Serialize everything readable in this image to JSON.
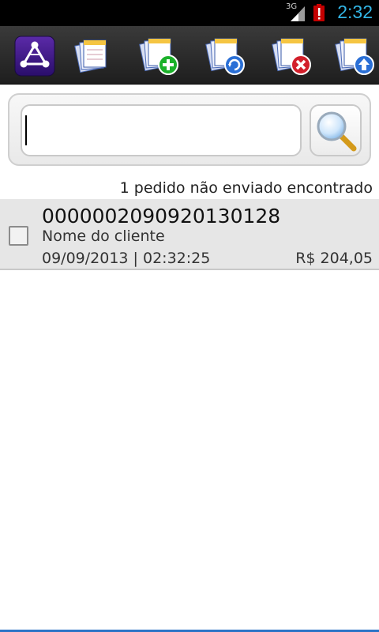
{
  "status_bar": {
    "network": "3G",
    "time": "2:32",
    "clock_color": "#33b5e5"
  },
  "toolbar": {
    "buttons": [
      {
        "icon": "app-logo-icon"
      },
      {
        "icon": "orders-icon"
      },
      {
        "icon": "new-order-icon"
      },
      {
        "icon": "sync-orders-icon"
      },
      {
        "icon": "delete-order-icon"
      },
      {
        "icon": "send-order-icon"
      }
    ]
  },
  "search": {
    "value": "",
    "icon": "magnifier-icon"
  },
  "results": {
    "count_text": "1 pedido não enviado encontrado"
  },
  "orders": [
    {
      "id": "0000002090920130128",
      "client": "Nome do cliente",
      "datetime": "09/09/2013 | 02:32:25",
      "amount": "R$ 204,05",
      "checked": false
    }
  ]
}
